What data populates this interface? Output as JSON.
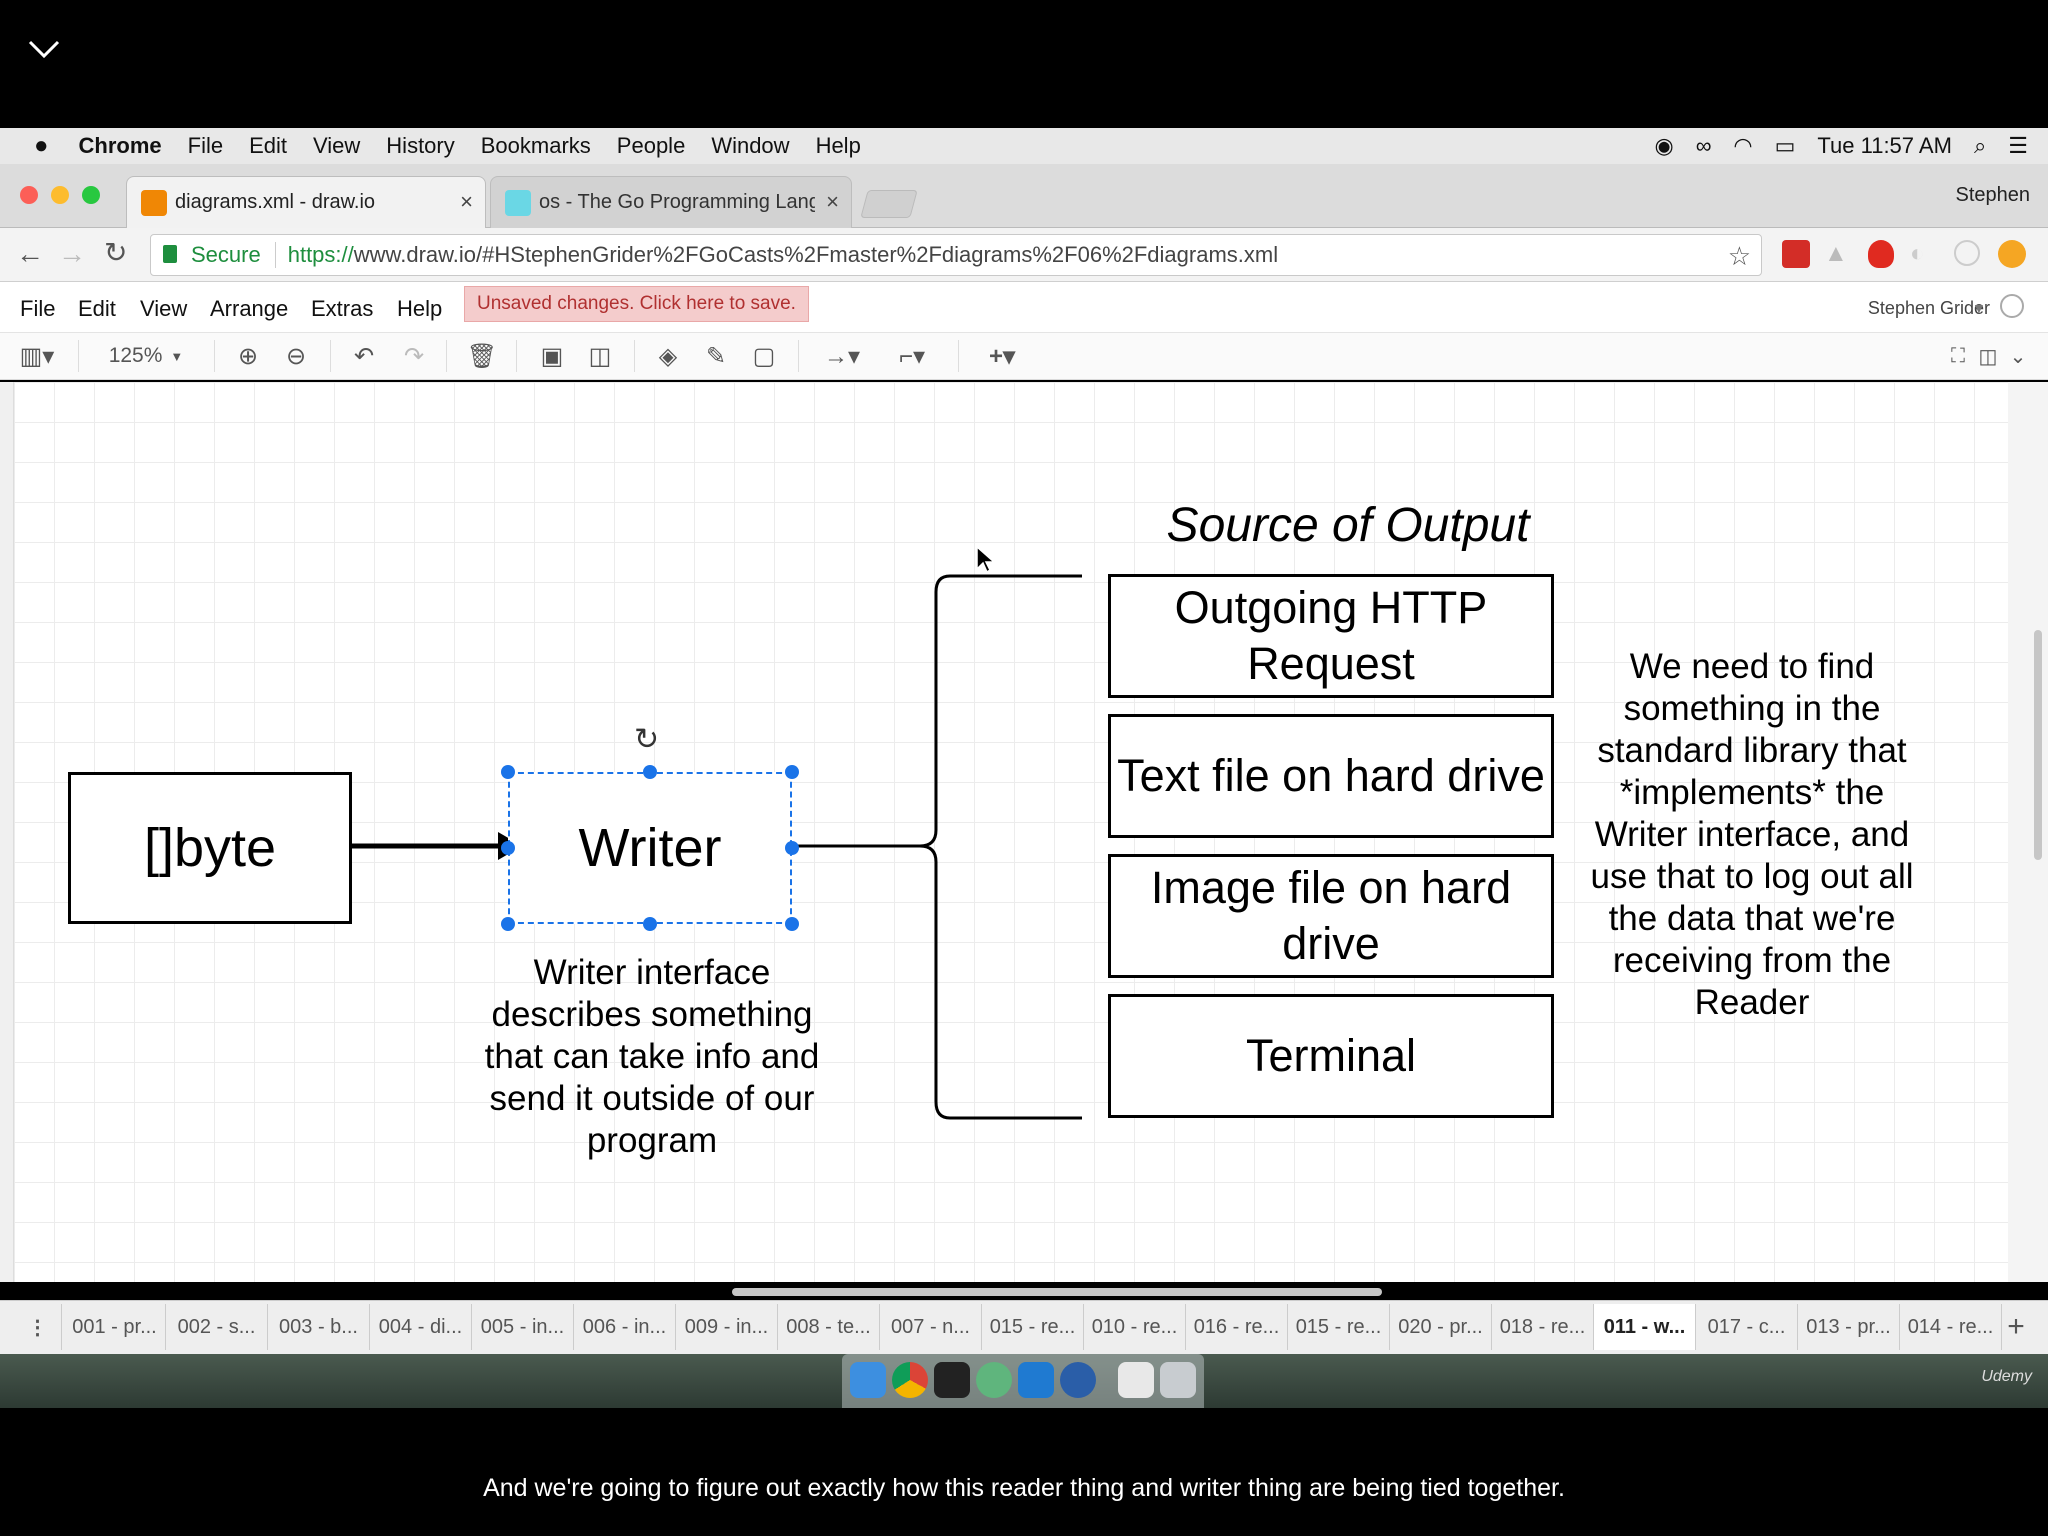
{
  "menubar": {
    "app": "Chrome",
    "items": [
      "File",
      "Edit",
      "View",
      "History",
      "Bookmarks",
      "People",
      "Window",
      "Help"
    ],
    "clock": "Tue 11:57 AM"
  },
  "browser": {
    "tabs": [
      {
        "title": "diagrams.xml - draw.io"
      },
      {
        "title": "os - The Go Programming Lang"
      }
    ],
    "profile": "Stephen",
    "secure_label": "Secure",
    "url_scheme": "https://",
    "url_rest": "www.draw.io/#HStephenGrider%2FGoCasts%2Fmaster%2Fdiagrams%2F06%2Fdiagrams.xml"
  },
  "drawio": {
    "menus": [
      "File",
      "Edit",
      "View",
      "Arrange",
      "Extras",
      "Help"
    ],
    "unsaved": "Unsaved changes. Click here to save.",
    "user": "Stephen Grider",
    "zoom": "125%"
  },
  "diagram": {
    "byte_box": "[]byte",
    "writer_box": "Writer",
    "writer_note": "Writer interface describes something that can take info and send it outside of our program",
    "source_title": "Source of Output",
    "outputs": [
      "Outgoing HTTP Request",
      "Text file on hard drive",
      "Image file on hard drive",
      "Terminal"
    ],
    "side_note": "We need to find something in the standard library that *implements* the Writer interface, and use that to log out all the data that we're receiving from the Reader"
  },
  "pages": [
    "001 - pr...",
    "002 - s...",
    "003 - b...",
    "004 - di...",
    "005 - in...",
    "006 - in...",
    "009 - in...",
    "008 - te...",
    "007 - n...",
    "015 - re...",
    "010 - re...",
    "016 - re...",
    "015 - re...",
    "020 - pr...",
    "018 - re...",
    "011 - w...",
    "017 - c...",
    "013 - pr...",
    "014 - re..."
  ],
  "active_page": "011 - w...",
  "watermark": "Udemy",
  "caption": "And we're going to figure out exactly how this reader thing and writer thing are being tied together.",
  "colors": {
    "selection": "#1a73e8",
    "unsaved_bg": "#f4cccc",
    "unsaved_text": "#b03030"
  }
}
